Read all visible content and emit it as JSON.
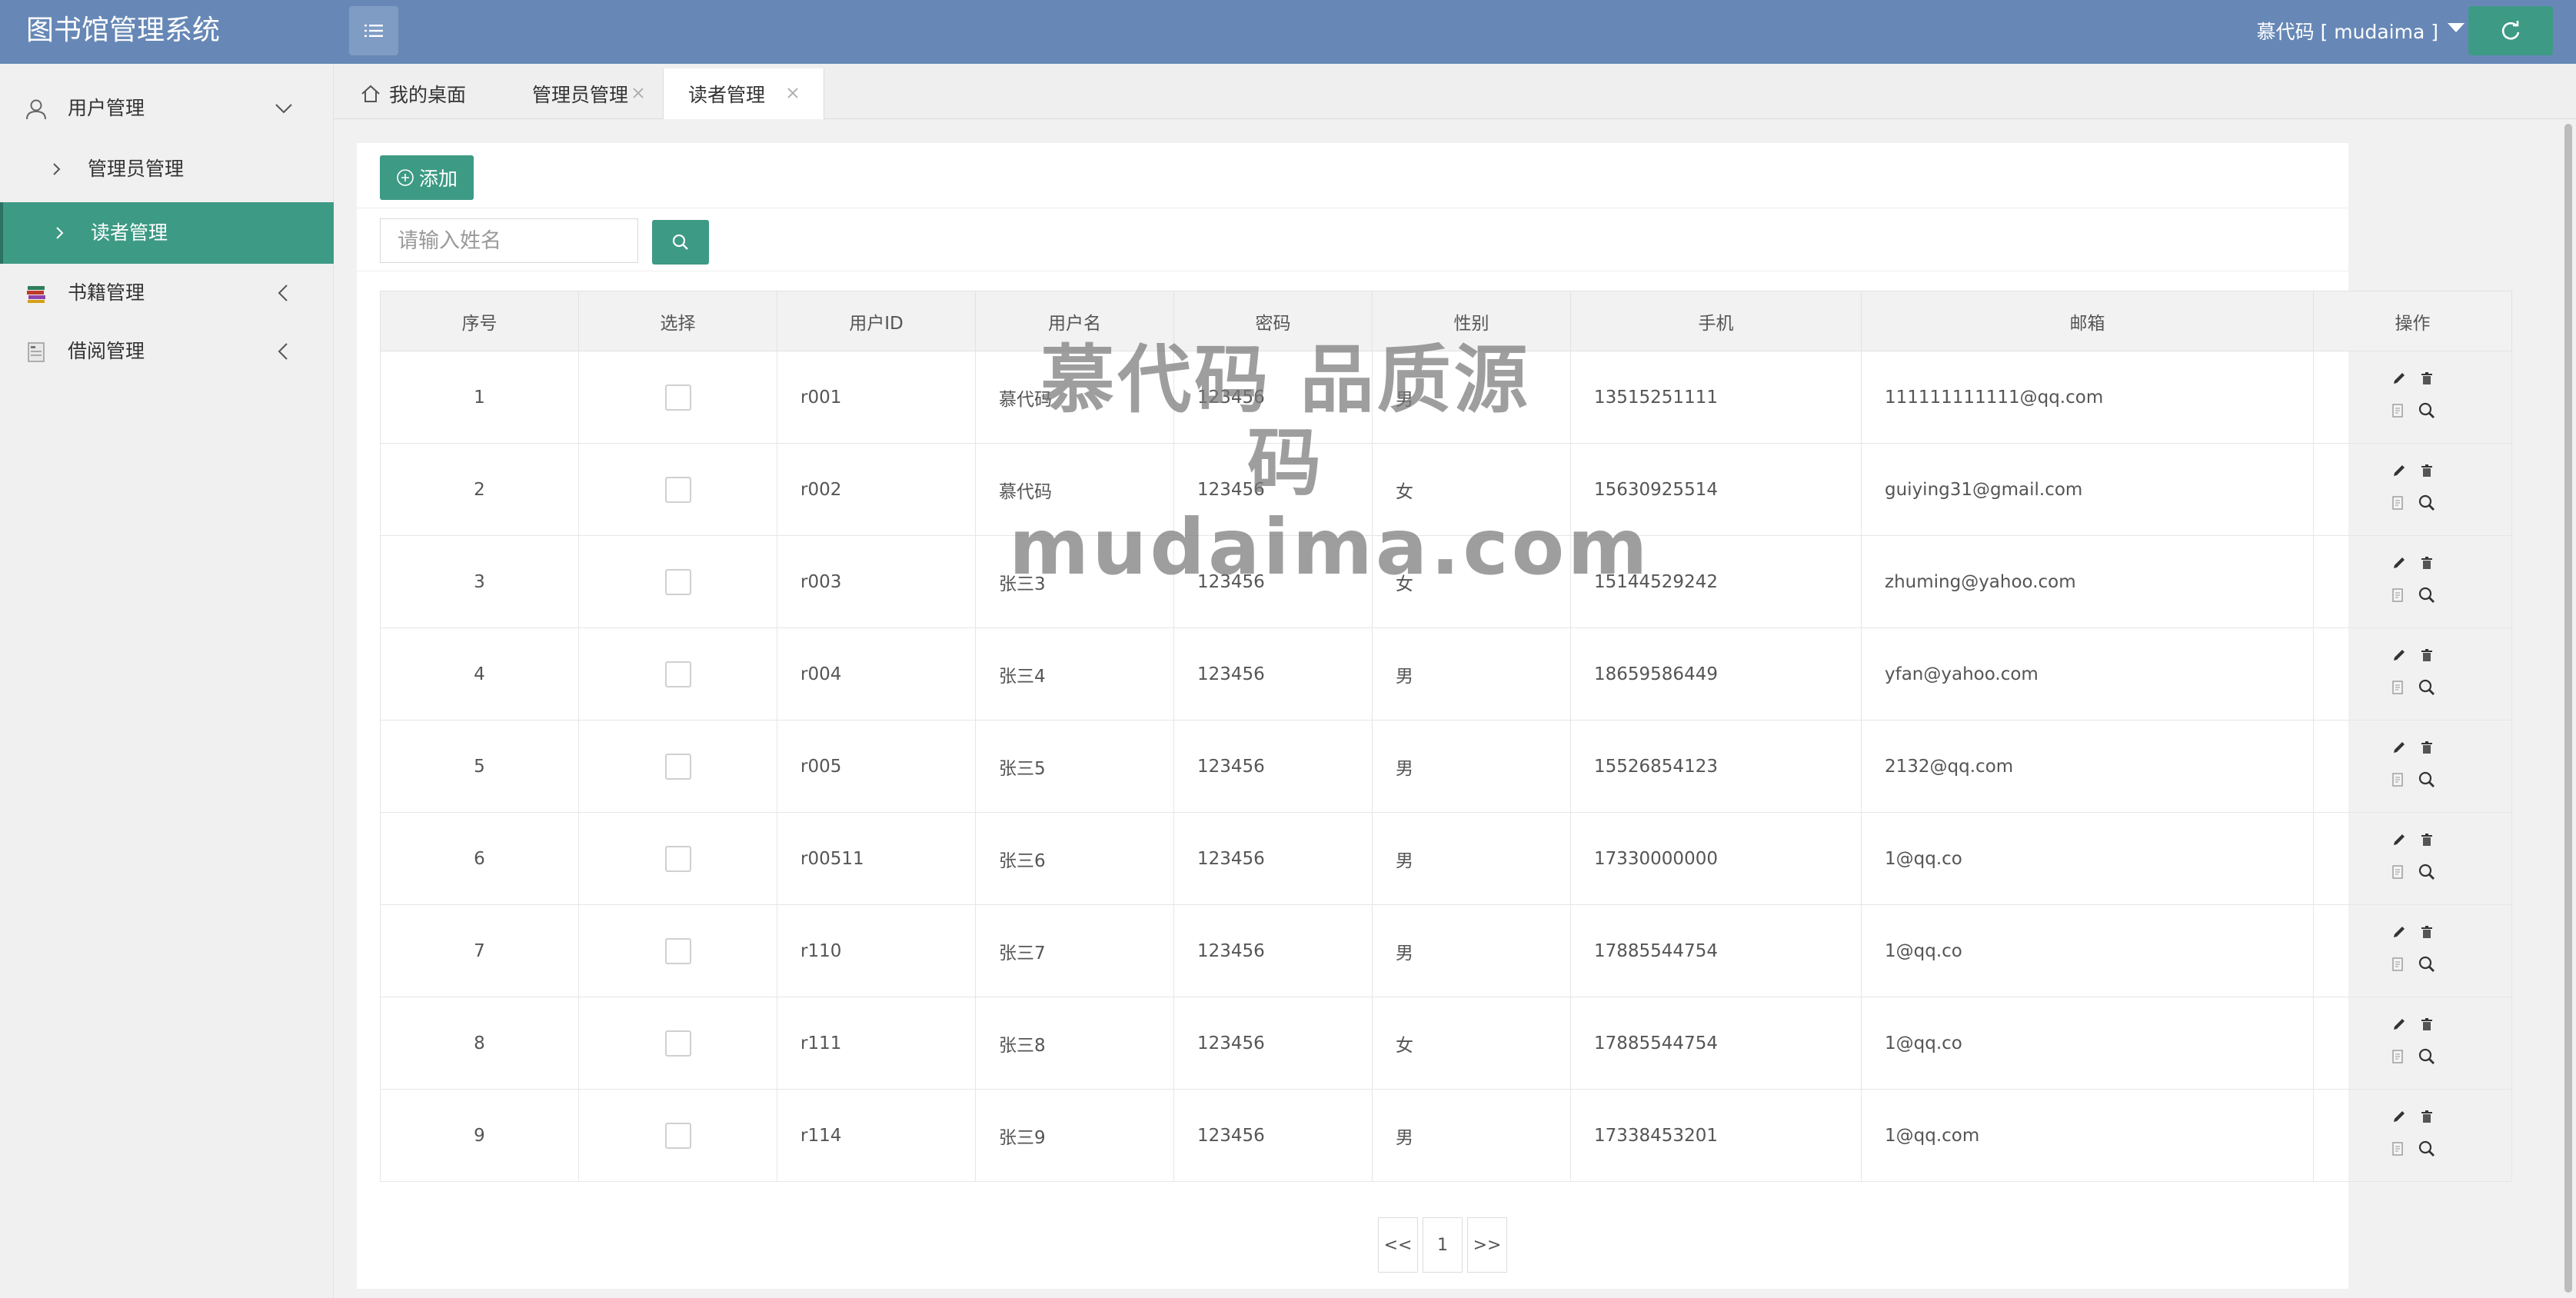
{
  "app": {
    "title": "图书馆管理系统"
  },
  "header": {
    "user_label": "慕代码 [ mudaima ]",
    "icons": {
      "menu": "list-icon",
      "refresh": "refresh-icon",
      "caret": "caret-down-icon"
    }
  },
  "sidebar": {
    "groups": [
      {
        "label": "用户管理",
        "icon": "user-icon",
        "expanded": true
      },
      {
        "label": "书籍管理",
        "icon": "books-icon",
        "expanded": false
      },
      {
        "label": "借阅管理",
        "icon": "borrow-icon",
        "expanded": false
      }
    ],
    "subitems": [
      {
        "label": "管理员管理",
        "active": false
      },
      {
        "label": "读者管理",
        "active": true
      }
    ]
  },
  "tabs": [
    {
      "label": "我的桌面",
      "icon": "home-icon",
      "closable": false,
      "active": false
    },
    {
      "label": "管理员管理",
      "closable": true,
      "active": false
    },
    {
      "label": "读者管理",
      "closable": true,
      "active": true
    }
  ],
  "toolbar": {
    "add_label": "添加",
    "search_placeholder": "请输入姓名"
  },
  "table": {
    "headers": [
      "序号",
      "选择",
      "用户ID",
      "用户名",
      "密码",
      "性别",
      "手机",
      "邮箱",
      "操作"
    ],
    "rows": [
      {
        "no": "1",
        "id": "r001",
        "name": "慕代码",
        "password": "123456",
        "gender": "男",
        "phone": "13515251111",
        "email": "111111111111@qq.com"
      },
      {
        "no": "2",
        "id": "r002",
        "name": "慕代码",
        "password": "123456",
        "gender": "女",
        "phone": "15630925514",
        "email": "guiying31@gmail.com"
      },
      {
        "no": "3",
        "id": "r003",
        "name": "张三3",
        "password": "123456",
        "gender": "女",
        "phone": "15144529242",
        "email": "zhuming@yahoo.com"
      },
      {
        "no": "4",
        "id": "r004",
        "name": "张三4",
        "password": "123456",
        "gender": "男",
        "phone": "18659586449",
        "email": "yfan@yahoo.com"
      },
      {
        "no": "5",
        "id": "r005",
        "name": "张三5",
        "password": "123456",
        "gender": "男",
        "phone": "15526854123",
        "email": "2132@qq.com"
      },
      {
        "no": "6",
        "id": "r00511",
        "name": "张三6",
        "password": "123456",
        "gender": "男",
        "phone": "17330000000",
        "email": "1@qq.co"
      },
      {
        "no": "7",
        "id": "r110",
        "name": "张三7",
        "password": "123456",
        "gender": "男",
        "phone": "17885544754",
        "email": "1@qq.co"
      },
      {
        "no": "8",
        "id": "r111",
        "name": "张三8",
        "password": "123456",
        "gender": "女",
        "phone": "17885544754",
        "email": "1@qq.co"
      },
      {
        "no": "9",
        "id": "r114",
        "name": "张三9",
        "password": "123456",
        "gender": "男",
        "phone": "17338453201",
        "email": "1@qq.com"
      }
    ],
    "row_actions": [
      "edit-icon",
      "delete-icon",
      "document-icon",
      "view-icon"
    ]
  },
  "pagination": {
    "prev": "<<",
    "current": "1",
    "next": ">>"
  },
  "watermark": {
    "line1": "慕代码 品质源码",
    "line2": "mudaima.com"
  },
  "colors": {
    "header_bg": "#6788b6",
    "accent": "#3d9a85",
    "sidebar_bg": "#f0f0f0"
  }
}
